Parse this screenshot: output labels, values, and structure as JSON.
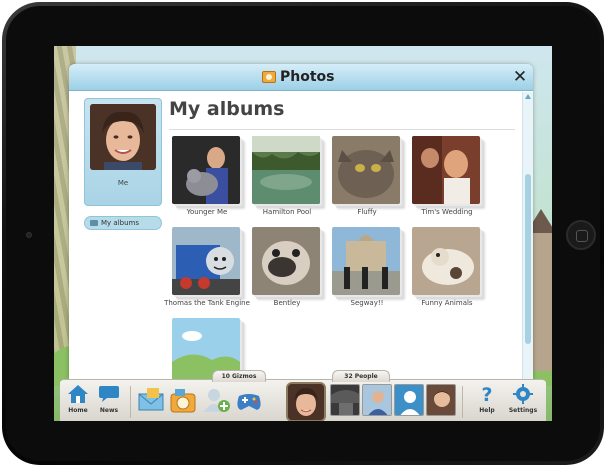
{
  "dialog": {
    "title": "Photos",
    "close_glyph": "✕",
    "heading": "My albums"
  },
  "profile": {
    "name": "Me"
  },
  "sidebar": {
    "items": [
      {
        "label": "My albums",
        "selected": true
      }
    ]
  },
  "albums": [
    {
      "label": "Younger Me"
    },
    {
      "label": "Hamilton Pool"
    },
    {
      "label": "Fluffy"
    },
    {
      "label": "Tim's Wedding"
    },
    {
      "label": "Thomas the Tank Engine"
    },
    {
      "label": "Bentley"
    },
    {
      "label": "Segway!!"
    },
    {
      "label": "Funny Animals"
    },
    {
      "label": ""
    }
  ],
  "dock": {
    "home_label": "Home",
    "news_label": "News",
    "gizmos_tab": "10 Gizmos",
    "people_tab": "32 People",
    "help_label": "Help",
    "settings_label": "Settings"
  },
  "colors": {
    "accent": "#9cd0e6",
    "dock": "#d9d6cf"
  }
}
